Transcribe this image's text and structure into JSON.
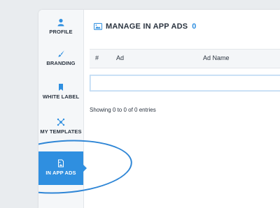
{
  "sidebar": {
    "items": [
      {
        "label": "PROFILE",
        "icon": "user-icon"
      },
      {
        "label": "BRANDING",
        "icon": "brush-icon"
      },
      {
        "label": "WHITE LABEL",
        "icon": "bookmark-icon"
      },
      {
        "label": "MY TEMPLATES",
        "icon": "network-icon"
      },
      {
        "label": "IN APP ADS",
        "icon": "image-file-icon",
        "active": true
      }
    ]
  },
  "header": {
    "title": "MANAGE IN APP ADS",
    "count": "0",
    "icon": "image-icon"
  },
  "table": {
    "columns": [
      "#",
      "Ad",
      "Ad Name"
    ],
    "info": "Showing 0 to 0 of 0 entries"
  },
  "colors": {
    "accent": "#2f8fe0",
    "text": "#2b3440"
  }
}
